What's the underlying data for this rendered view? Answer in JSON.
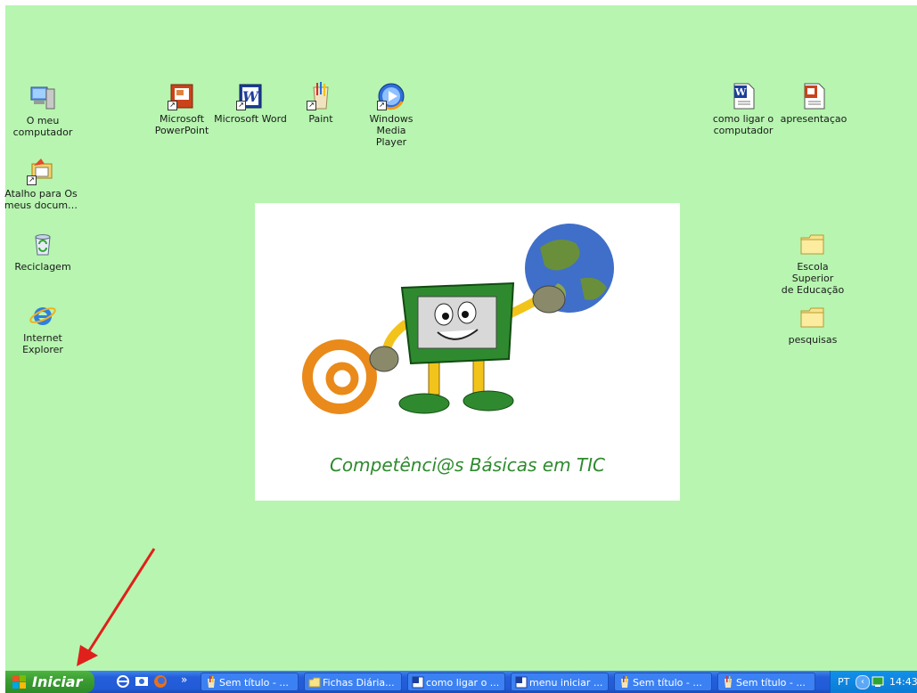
{
  "desktop": {
    "background": "#b7f5b0",
    "icons": [
      {
        "label": "O meu\ncomputador",
        "icon": "my-computer-icon"
      },
      {
        "label": "Atalho para Os\nmeus docum…",
        "icon": "my-documents-shortcut-icon"
      },
      {
        "label": "Reciclagem",
        "icon": "recycle-bin-icon"
      },
      {
        "label": "Internet\nExplorer",
        "icon": "internet-explorer-icon"
      },
      {
        "label": "Microsoft\nPowerPoint",
        "icon": "powerpoint-icon"
      },
      {
        "label": "Microsoft Word",
        "icon": "word-icon"
      },
      {
        "label": "Paint",
        "icon": "paint-icon"
      },
      {
        "label": "Windows Media\nPlayer",
        "icon": "media-player-icon"
      },
      {
        "label": "como ligar o\ncomputador",
        "icon": "word-document-icon"
      },
      {
        "label": "apresentaçao",
        "icon": "powerpoint-document-icon"
      },
      {
        "label": "Escola Superior\nde Educação",
        "icon": "folder-icon"
      },
      {
        "label": "pesquisas",
        "icon": "folder-icon"
      }
    ],
    "wallpaper": {
      "caption": "Competênci@s Básicas em TIC",
      "caption_color": "#2e8b2e"
    }
  },
  "taskbar": {
    "start_label": "Iniciar",
    "quick_launch": [
      "internet-explorer-icon",
      "outlook-express-icon",
      "firefox-icon"
    ],
    "quick_launch_more": "»",
    "tasks": [
      {
        "label": "Sem título - ...",
        "icon": "paint-icon"
      },
      {
        "label": "Fichas Diária...",
        "icon": "folder-icon"
      },
      {
        "label": "como ligar o ...",
        "icon": "word-icon"
      },
      {
        "label": "menu iniciar ...",
        "icon": "word-icon"
      },
      {
        "label": "Sem título - ...",
        "icon": "paint-icon"
      },
      {
        "label": "Sem título - ...",
        "icon": "paint-icon"
      }
    ],
    "tray": {
      "language": "PT",
      "arrow": "‹",
      "time": "14:43"
    }
  },
  "annotation": {
    "color": "#e0201a"
  }
}
